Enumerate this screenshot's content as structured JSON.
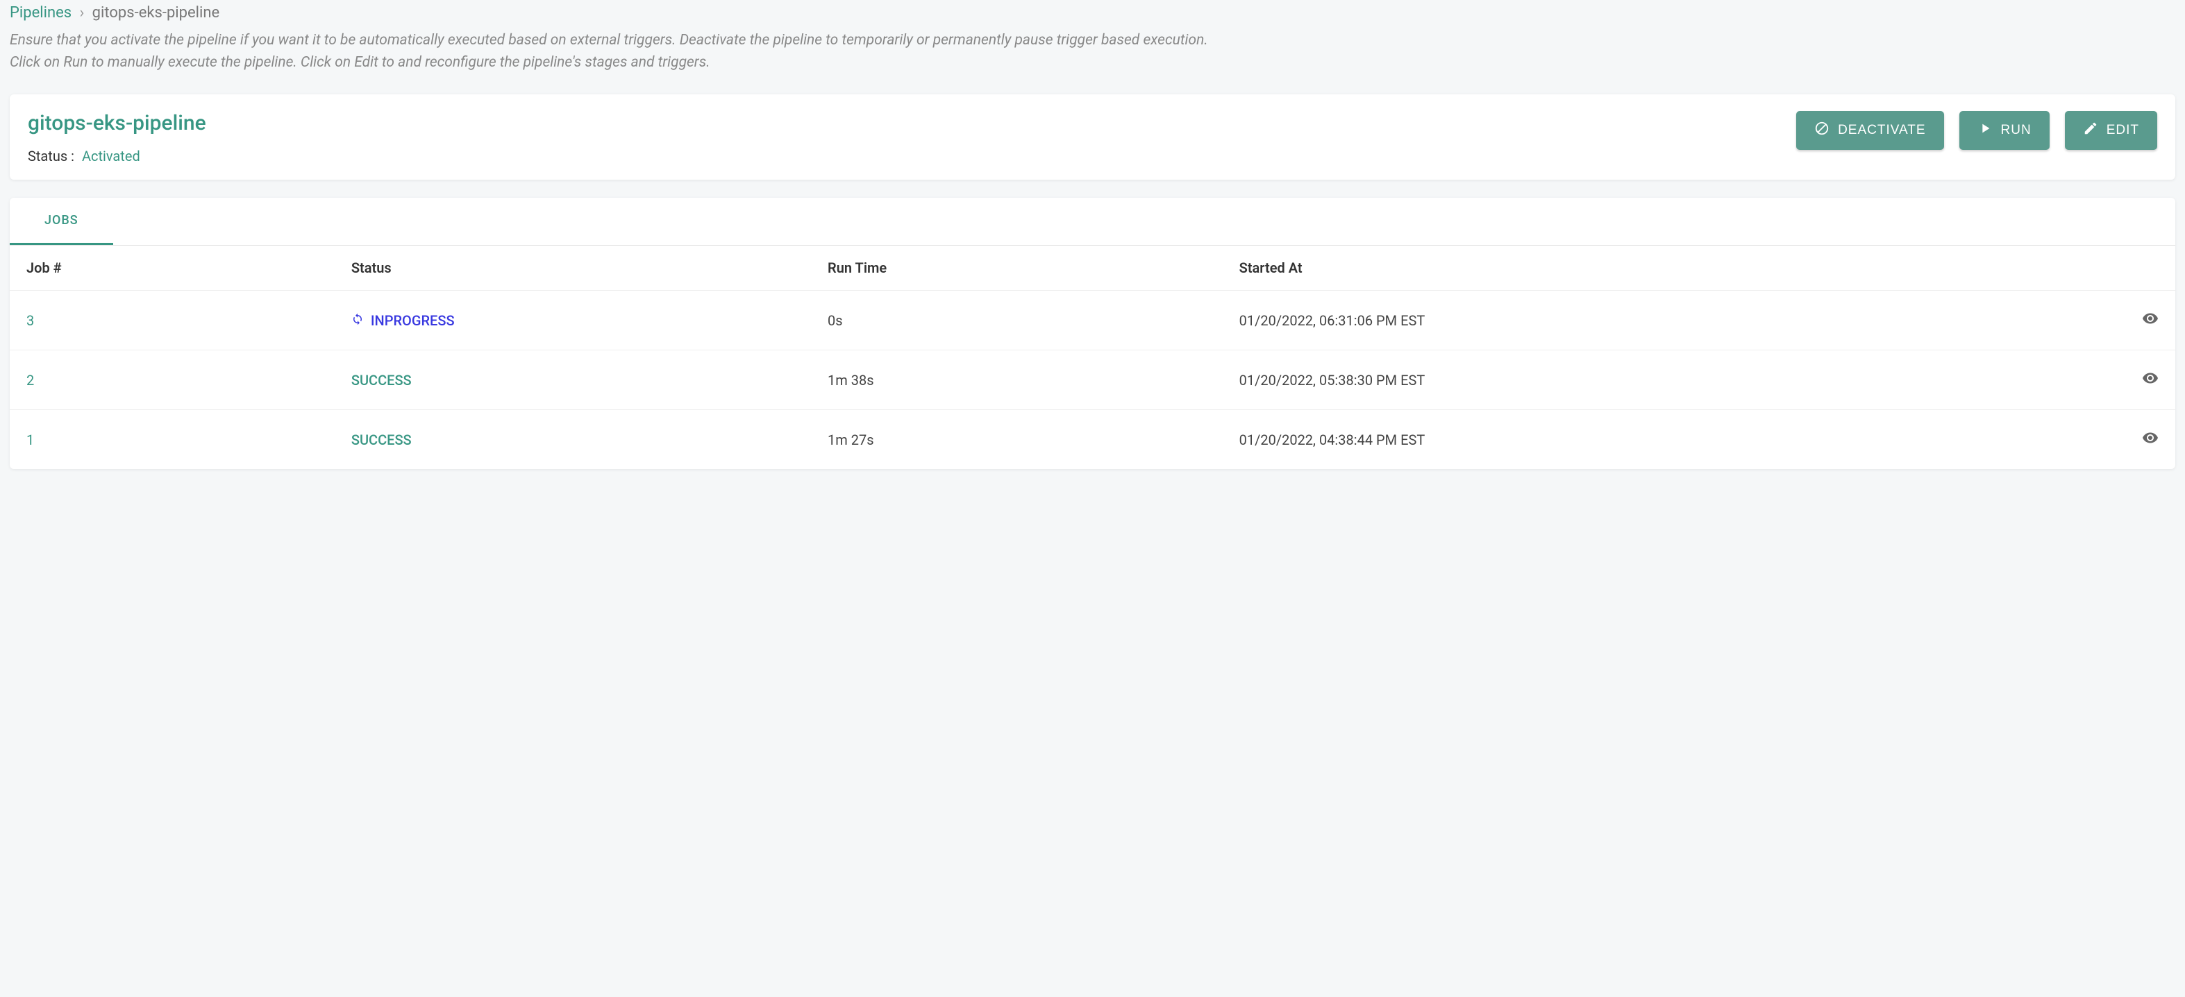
{
  "breadcrumb": {
    "root": "Pipelines",
    "separator": "›",
    "current": "gitops-eks-pipeline"
  },
  "help": {
    "line1": "Ensure that you activate the pipeline if you want it to be automatically executed based on external triggers. Deactivate the pipeline to temporarily or permanently pause trigger based execution.",
    "line2": "Click on Run to manually execute the pipeline. Click on Edit to and reconfigure the pipeline's stages and triggers."
  },
  "header": {
    "title": "gitops-eks-pipeline",
    "status_label": "Status :",
    "status_value": "Activated",
    "buttons": {
      "deactivate": "DEACTIVATE",
      "run": "RUN",
      "edit": "EDIT"
    }
  },
  "tabs": {
    "jobs": "JOBS"
  },
  "table": {
    "headers": {
      "job": "Job #",
      "status": "Status",
      "runtime": "Run Time",
      "started": "Started At"
    },
    "rows": [
      {
        "num": "3",
        "status": "INPROGRESS",
        "status_type": "inprogress",
        "runtime": "0s",
        "started": "01/20/2022, 06:31:06 PM EST"
      },
      {
        "num": "2",
        "status": "SUCCESS",
        "status_type": "success",
        "runtime": "1m 38s",
        "started": "01/20/2022, 05:38:30 PM EST"
      },
      {
        "num": "1",
        "status": "SUCCESS",
        "status_type": "success",
        "runtime": "1m 27s",
        "started": "01/20/2022, 04:38:44 PM EST"
      }
    ]
  }
}
